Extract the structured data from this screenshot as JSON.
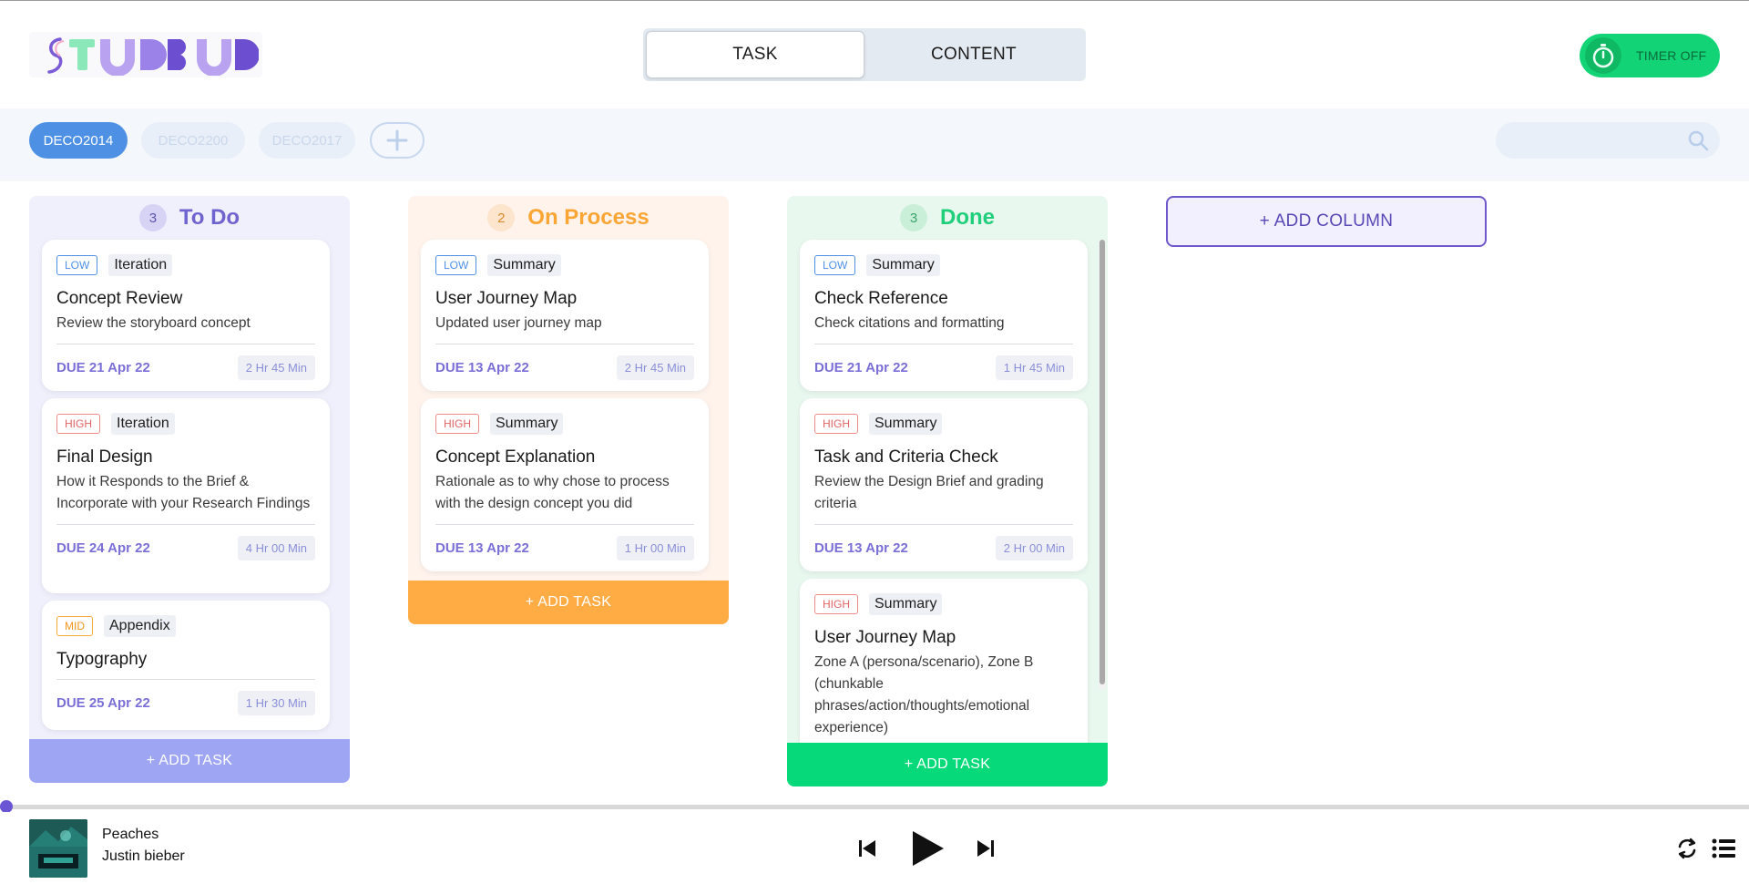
{
  "header": {
    "logo_text": "STUDBUD",
    "tabs": [
      {
        "label": "TASK",
        "active": true
      },
      {
        "label": "CONTENT",
        "active": false
      }
    ],
    "timer_label": "TIMER OFF"
  },
  "subbar": {
    "units": [
      {
        "label": "DECO2014",
        "active": true
      },
      {
        "label": "DECO2200",
        "active": false
      },
      {
        "label": "DECO2017",
        "active": false
      }
    ],
    "search": {
      "placeholder": "",
      "value": ""
    }
  },
  "columns": [
    {
      "title": "To Do",
      "count": "3",
      "add_label": "+ ADD TASK",
      "tasks": [
        {
          "priority": "LOW",
          "category": "Iteration",
          "title": "Concept Review",
          "desc": "Review the storyboard concept",
          "due": "DUE 21 Apr 22",
          "duration": "2 Hr 45 Min"
        },
        {
          "priority": "HIGH",
          "category": "Iteration",
          "title": "Final Design",
          "desc": "How it Responds to the Brief & Incorporate with your Research Findings",
          "due": "DUE 24 Apr 22",
          "duration": "4 Hr 00 Min"
        },
        {
          "priority": "MID",
          "category": "Appendix",
          "title": "Typography",
          "desc": "",
          "due": "DUE 25 Apr 22",
          "duration": "1 Hr 30 Min"
        }
      ]
    },
    {
      "title": "On Process",
      "count": "2",
      "add_label": "+ ADD TASK",
      "tasks": [
        {
          "priority": "LOW",
          "category": "Summary",
          "title": "User Journey Map",
          "desc": "Updated user journey map",
          "due": "DUE 13 Apr 22",
          "duration": "2 Hr 45 Min"
        },
        {
          "priority": "HIGH",
          "category": "Summary",
          "title": "Concept Explanation",
          "desc": "Rationale as to why chose to process with the design concept you did",
          "due": "DUE 13 Apr 22",
          "duration": "1 Hr 00 Min"
        }
      ]
    },
    {
      "title": "Done",
      "count": "3",
      "add_label": "+ ADD TASK",
      "tasks": [
        {
          "priority": "LOW",
          "category": "Summary",
          "title": "Check Reference",
          "desc": "Check citations and formatting",
          "due": "DUE 21 Apr 22",
          "duration": "1 Hr 45 Min"
        },
        {
          "priority": "HIGH",
          "category": "Summary",
          "title": "Task and Criteria Check",
          "desc": "Review the Design Brief and grading criteria",
          "due": "DUE 13 Apr 22",
          "duration": "2 Hr 00 Min"
        },
        {
          "priority": "HIGH",
          "category": "Summary",
          "title": "User Journey Map",
          "desc": "Zone A (persona/scenario), Zone B (chunkable phrases/action/thoughts/emotional experience)",
          "due": "",
          "duration": ""
        }
      ]
    }
  ],
  "add_column_label": "+ ADD COLUMN",
  "player": {
    "song": "Peaches",
    "artist": "Justin bieber",
    "progress": 0
  },
  "colors": {
    "accent_blue": "#4e91e4",
    "todo": "#9ea6f4",
    "process": "#ffac45",
    "done": "#05d97a",
    "timer": "#12d477"
  },
  "icons": [
    "stopwatch-icon",
    "plus-icon",
    "search-icon",
    "previous-icon",
    "play-icon",
    "next-icon",
    "repeat-icon",
    "queue-icon"
  ]
}
